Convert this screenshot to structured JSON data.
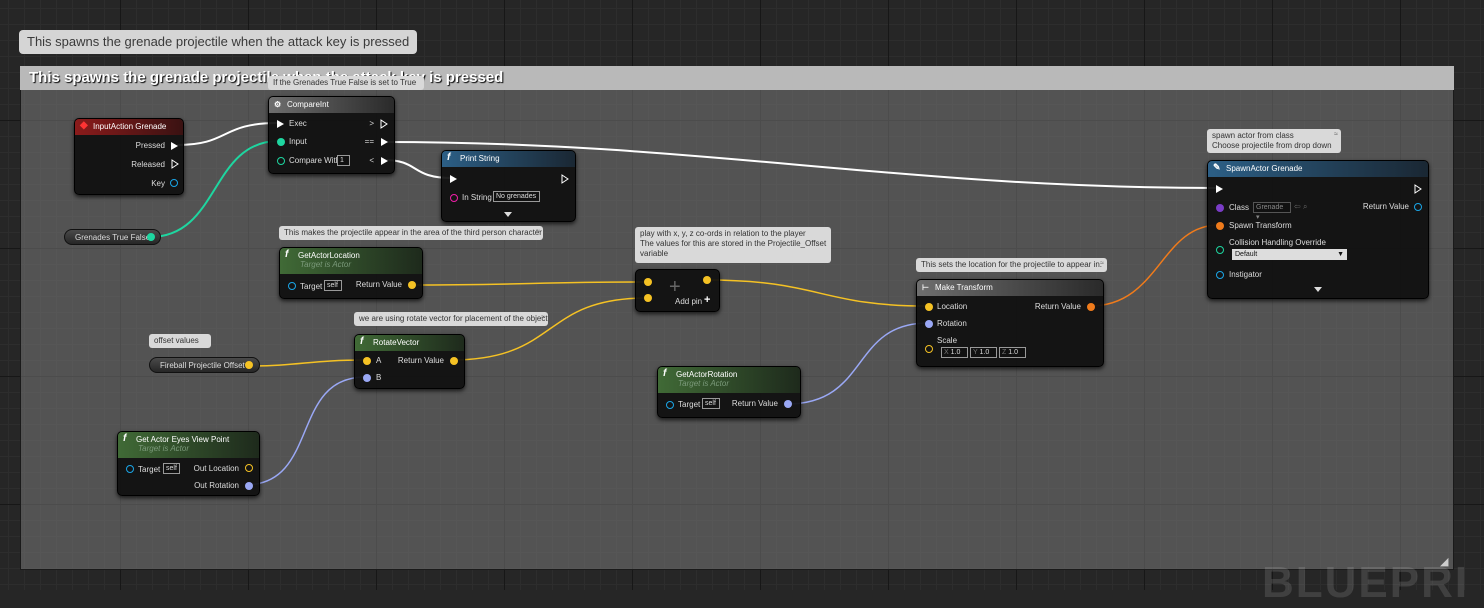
{
  "graph": {
    "comment_top": "This spawns the grenade projectile when the attack key is pressed",
    "comment_box_title": "This spawns the grenade projectile when the attack key is pressed",
    "watermark": "BLUEPRI"
  },
  "nodes": {
    "input_action": {
      "title": "InputAction Grenade",
      "pins": [
        "Pressed",
        "Released",
        "Key"
      ]
    },
    "grenades_var": {
      "label": "Grenades True False"
    },
    "compare_int": {
      "title": "CompareInt",
      "comment": "If the Grenades True False is set to True",
      "exec": "Exec",
      "input": "Input",
      "compare_with": "Compare With",
      "compare_value": "1",
      "out_gt": ">",
      "out_eq": "==",
      "out_lt": "<"
    },
    "print_string": {
      "title": "Print String",
      "in_string": "In String",
      "in_string_value": "No grenades"
    },
    "get_actor_location": {
      "title": "GetActorLocation",
      "subtitle": "Target is Actor",
      "comment": "This makes the projectile appear in the area of the third person character",
      "target": "Target",
      "target_value": "self",
      "return": "Return Value"
    },
    "add_node": {
      "comment_lines": [
        "play with x, y, z co-ords in relation to the player",
        "The values for this are stored in the Projectile_Offset",
        "variable"
      ],
      "add_pin": "Add pin",
      "symbol": "+"
    },
    "offset_bubble": {
      "text": "offset values"
    },
    "fireball_var": {
      "label": "Fireball Projectile Offset"
    },
    "rotate_vector": {
      "title": "RotateVector",
      "comment": "we are using rotate vector for placement of the object",
      "a": "A",
      "b": "B",
      "return": "Return Value"
    },
    "eyes_view": {
      "title": "Get Actor Eyes View Point",
      "subtitle": "Target is Actor",
      "target": "Target",
      "target_value": "self",
      "out_location": "Out Location",
      "out_rotation": "Out Rotation"
    },
    "get_actor_rotation": {
      "title": "GetActorRotation",
      "subtitle": "Target is Actor",
      "target": "Target",
      "target_value": "self",
      "return": "Return Value"
    },
    "make_transform": {
      "title": "Make Transform",
      "comment": "This sets the location for the projectile to appear in.",
      "location": "Location",
      "rotation": "Rotation",
      "scale": "Scale",
      "return": "Return Value",
      "scale_x_label": "X",
      "scale_x": "1.0",
      "scale_y_label": "Y",
      "scale_y": "1.0",
      "scale_z_label": "Z",
      "scale_z": "1.0"
    },
    "spawn_actor": {
      "title": "SpawnActor Grenade",
      "comment_lines": [
        "spawn actor from class",
        "Choose projectile from drop down"
      ],
      "class": "Class",
      "class_value": "Grenade",
      "return": "Return Value",
      "spawn_transform": "Spawn Transform",
      "collision": "Collision Handling Override",
      "collision_value": "Default",
      "instigator": "Instigator"
    }
  },
  "colors": {
    "exec": "#ffffff",
    "int": "#1ed6a0",
    "vector": "#f5c224",
    "rotator": "#9aa8f5",
    "transform": "#f07b1b",
    "object": "#1aa6e8",
    "string": "#f01ea8"
  }
}
